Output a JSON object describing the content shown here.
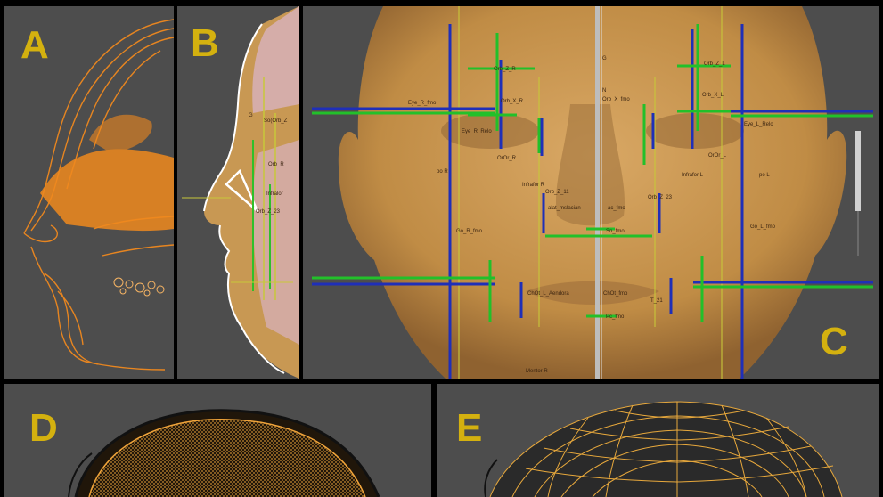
{
  "panels": {
    "a": {
      "letter": "A"
    },
    "b": {
      "letter": "B"
    },
    "c": {
      "letter": "C"
    },
    "d": {
      "letter": "D"
    },
    "e": {
      "letter": "E"
    }
  },
  "landmarks_b": [
    "G",
    "So(Orb_Z",
    "Orb_R",
    "Infralor",
    "Orb_Z_23"
  ],
  "landmarks_c": [
    "Orb_Z_R",
    "Eye_R_fmo",
    "Orb_X_R",
    "Eye_R_Relo",
    "OrOr_R",
    "N",
    "Orb_X_fmo",
    "G",
    "Orb_Z_L",
    "Orb_X_L",
    "Eye_L_Relo",
    "OrOr_L",
    "Infrafor R",
    "Infrafor L",
    "po R",
    "po L",
    "Orb_Z_11",
    "alat_mslacian",
    "ac_fmo",
    "Orb_Z_23",
    "Go_R_fmo",
    "Go_L_fmo",
    "Sn_fmo",
    "ChOt_L_Aendora",
    "ChOt_fmo",
    "Pc_fmo",
    "T_21",
    "Mentor R"
  ],
  "colors": {
    "accent_letter": "#d4b10f",
    "axis_blue": "#1f2fb8",
    "axis_green": "#22c02a",
    "wire_orange": "#f0891e",
    "background": "#4d4d4d"
  }
}
